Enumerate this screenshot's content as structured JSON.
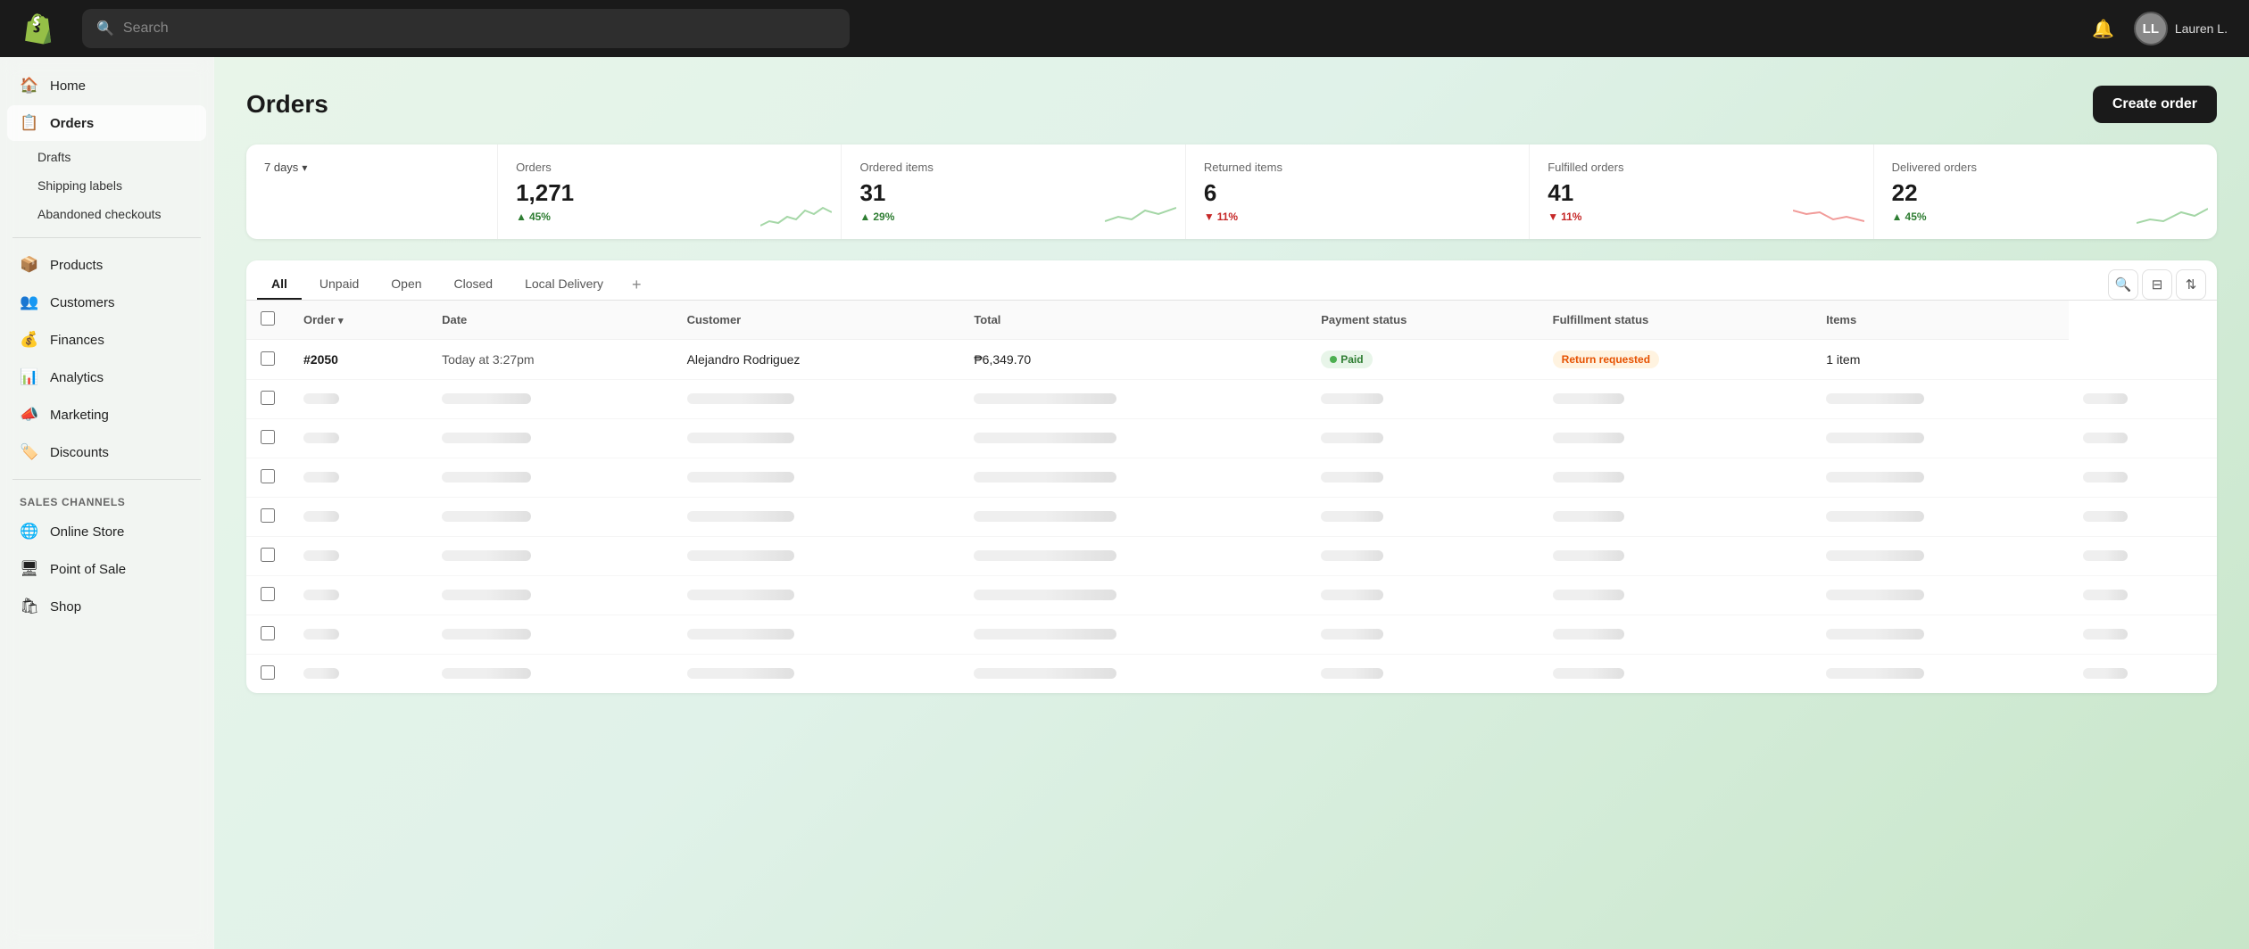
{
  "topnav": {
    "search_placeholder": "Search",
    "user_name": "Lauren L.",
    "user_initials": "LL"
  },
  "sidebar": {
    "items": [
      {
        "id": "home",
        "label": "Home",
        "icon": "🏠",
        "active": false
      },
      {
        "id": "orders",
        "label": "Orders",
        "icon": "📋",
        "active": true
      },
      {
        "id": "drafts",
        "label": "Drafts",
        "icon": "📄",
        "sub": true
      },
      {
        "id": "shipping-labels",
        "label": "Shipping labels",
        "icon": "🏷",
        "sub": true
      },
      {
        "id": "abandoned-checkouts",
        "label": "Abandoned checkouts",
        "icon": "🛒",
        "sub": true
      },
      {
        "id": "products",
        "label": "Products",
        "icon": "📦",
        "active": false
      },
      {
        "id": "customers",
        "label": "Customers",
        "icon": "👥",
        "active": false
      },
      {
        "id": "finances",
        "label": "Finances",
        "icon": "💰",
        "active": false
      },
      {
        "id": "analytics",
        "label": "Analytics",
        "icon": "📊",
        "active": false
      },
      {
        "id": "marketing",
        "label": "Marketing",
        "icon": "📣",
        "active": false
      },
      {
        "id": "discounts",
        "label": "Discounts",
        "icon": "🏷️",
        "active": false
      }
    ],
    "sales_channels_label": "Sales channels",
    "channels": [
      {
        "id": "online-store",
        "label": "Online Store",
        "icon": "🌐"
      },
      {
        "id": "point-of-sale",
        "label": "Point of Sale",
        "icon": "🖥"
      },
      {
        "id": "shop",
        "label": "Shop",
        "icon": "🛍"
      }
    ]
  },
  "page": {
    "title": "Orders",
    "create_order_label": "Create order"
  },
  "stats": [
    {
      "id": "period",
      "label": "7 days",
      "is_period": true
    },
    {
      "id": "orders-count",
      "label": "Orders",
      "value": "1,271",
      "change": "45%",
      "change_dir": "up"
    },
    {
      "id": "ordered-items",
      "label": "Ordered items",
      "value": "31",
      "change": "29%",
      "change_dir": "up"
    },
    {
      "id": "returned-items",
      "label": "Returned items",
      "value": "6",
      "change": "11%",
      "change_dir": "down"
    },
    {
      "id": "fulfilled-orders",
      "label": "Fulfilled orders",
      "value": "41",
      "change": "11%",
      "change_dir": "down"
    },
    {
      "id": "delivered-orders",
      "label": "Delivered orders",
      "value": "22",
      "change": "45%",
      "change_dir": "up"
    }
  ],
  "tabs": [
    {
      "id": "all",
      "label": "All",
      "active": true
    },
    {
      "id": "unpaid",
      "label": "Unpaid",
      "active": false
    },
    {
      "id": "open",
      "label": "Open",
      "active": false
    },
    {
      "id": "closed",
      "label": "Closed",
      "active": false
    },
    {
      "id": "local-delivery",
      "label": "Local Delivery",
      "active": false
    }
  ],
  "table": {
    "columns": [
      "Order",
      "Date",
      "Customer",
      "Total",
      "Payment status",
      "Fulfillment status",
      "Items"
    ],
    "rows": [
      {
        "order": "#2050",
        "date": "Today at 3:27pm",
        "customer": "Alejandro Rodriguez",
        "total": "₱6,349.70",
        "payment_status": "Paid",
        "payment_badge": "badge-green",
        "fulfillment_status": "Return requested",
        "fulfillment_badge": "badge-orange",
        "items": "1 item",
        "skeleton": false
      },
      {
        "skeleton": true
      },
      {
        "skeleton": true
      },
      {
        "skeleton": true
      },
      {
        "skeleton": true
      },
      {
        "skeleton": true
      },
      {
        "skeleton": true
      },
      {
        "skeleton": true
      },
      {
        "skeleton": true
      }
    ]
  },
  "icons": {
    "search": "🔍",
    "bell": "🔔",
    "chevron_down": "▾",
    "filter": "⊟",
    "columns": "⊞",
    "sort": "⇅",
    "plus": "+"
  }
}
